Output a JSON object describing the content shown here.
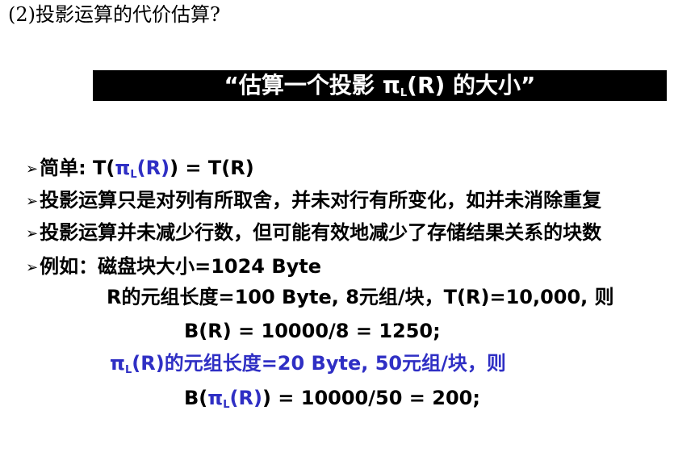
{
  "heading": "(2)投影运算的代价估算?",
  "banner": {
    "before": "“估算一个投影 ",
    "pi": "π",
    "sub": "L",
    "after": "(R) 的大小”"
  },
  "bullets": {
    "arrow": "➢",
    "simple": {
      "prefix": "简单:  T(",
      "pi": "π",
      "sub": "L",
      "mid": "(R)",
      "suffix": ") = T(R)"
    },
    "b2": "投影运算只是对列有所取舍，并未对行有所变化，如并未消除重复",
    "b3": "投影运算并未减少行数，但可能有效地减少了存储结果关系的块数",
    "example": "例如：磁盘块大小=1024 Byte"
  },
  "example": {
    "line1": "R的元组长度=100 Byte, 8元组/块，T(R)=10,000, 则",
    "line2": "B(R) = 10000/8 = 1250;",
    "line3": {
      "pi": "π",
      "sub": "L",
      "rest": "(R)的元组长度=20 Byte, 50元组/块，则"
    },
    "line4": {
      "prefix": "B(",
      "pi": "π",
      "sub": "L",
      "mid": "(R)",
      "suffix": ") = 10000/50 = 200;"
    }
  },
  "colors": {
    "accent_blue": "#2f2fc4",
    "banner_bg": "#000000",
    "banner_text": "#ffffff"
  }
}
